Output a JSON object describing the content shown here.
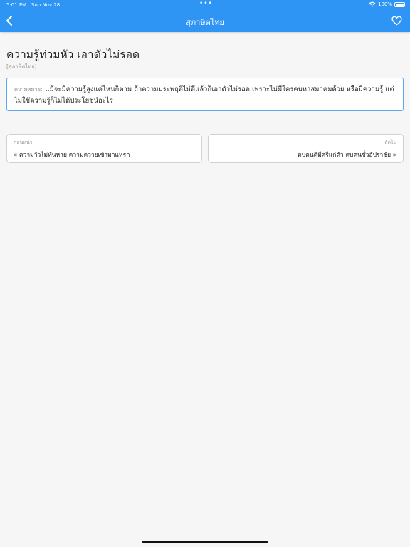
{
  "status_bar": {
    "time": "5:01 PM",
    "date": "Sun Nov 28",
    "battery": "100%"
  },
  "nav": {
    "title": "สุภาษิตไทย"
  },
  "proverb": {
    "title": "ความรู้ท่วมหัว เอาตัวไม่รอด",
    "category": "[สุภาษิตไทย]",
    "meaning_label": "ความหมาย:",
    "meaning": "แม้จะมีความรู้สูงแค่ไหนก็ตาม ถ้าความประพฤติไม่ดีแล้วก็เอาตัวไม่รอด เพราะไม่มีใครคบหาสมาคมด้วย หรือมีความรู้ แต่ไม่ใช้ความรู้ก็ไม่ได้ประโยชน์อะไร"
  },
  "navigation": {
    "prev_label": "ก่อนหน้า",
    "prev_text": "« ความวัวไม่ทันหาย ความควายเข้ามาแทรก",
    "next_label": "ถัดไป",
    "next_text": "คบคนดีมีศรีแก่ตัว คบคนชั่วอัปราชัย »"
  },
  "colors": {
    "accent": "#2f95f4",
    "background": "#f6f6f7"
  },
  "icons": {
    "back": "chevron-left-icon",
    "favorite": "heart-outline-icon",
    "wifi": "wifi-icon",
    "battery": "battery-icon"
  }
}
